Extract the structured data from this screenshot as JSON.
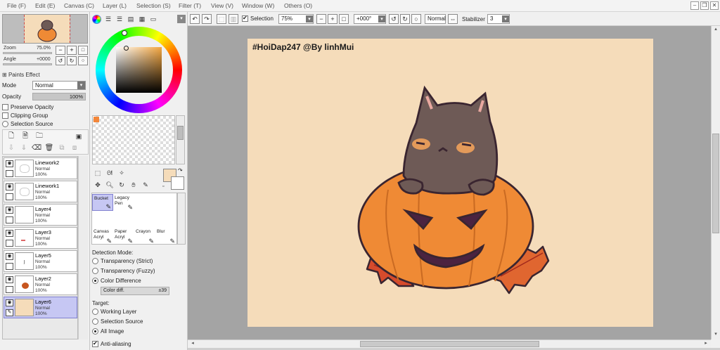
{
  "menubar": {
    "items": [
      "File (F)",
      "Edit (E)",
      "Canvas (C)",
      "Layer (L)",
      "Selection (S)",
      "Filter (T)",
      "View (V)",
      "Window (W)",
      "Others (O)"
    ]
  },
  "navigator": {
    "zoom_label": "Zoom",
    "zoom_value": "75.0%",
    "angle_label": "Angle",
    "angle_value": "+0000"
  },
  "layer_props": {
    "paints_effect": "Paints Effect",
    "mode_label": "Mode",
    "mode_value": "Normal",
    "opacity_label": "Opacity",
    "opacity_value": "100%",
    "preserve_opacity": "Preserve Opacity",
    "clipping_group": "Clipping Group",
    "selection_source": "Selection Source"
  },
  "layers": [
    {
      "name": "Linework2",
      "mode": "Normal",
      "opacity": "100%",
      "selected": false
    },
    {
      "name": "Linework1",
      "mode": "Normal",
      "opacity": "100%",
      "selected": false
    },
    {
      "name": "Layer4",
      "mode": "Normal",
      "opacity": "100%",
      "selected": false
    },
    {
      "name": "Layer3",
      "mode": "Normal",
      "opacity": "100%",
      "selected": false
    },
    {
      "name": "Layer5",
      "mode": "Normal",
      "opacity": "100%",
      "selected": false
    },
    {
      "name": "Layer2",
      "mode": "Normal",
      "opacity": "100%",
      "selected": false
    },
    {
      "name": "Layer6",
      "mode": "Normal",
      "opacity": "100%",
      "selected": true
    }
  ],
  "brushes": [
    {
      "label1": "Bucket",
      "label2": ""
    },
    {
      "label1": "Legacy",
      "label2": "Pen"
    },
    {
      "label1": "",
      "label2": ""
    },
    {
      "label1": "",
      "label2": ""
    },
    {
      "label1": "Canvas",
      "label2": "Acryl"
    },
    {
      "label1": "Paper",
      "label2": "Acryl"
    },
    {
      "label1": "Crayon",
      "label2": ""
    },
    {
      "label1": "Blur",
      "label2": ""
    }
  ],
  "bucket_options": {
    "detection_mode_label": "Detection Mode:",
    "opt_strict": "Transparency (Strict)",
    "opt_fuzzy": "Transparency (Fuzzy)",
    "opt_color_diff": "Color Difference",
    "color_diff_label": "Color diff.",
    "color_diff_value": "±39",
    "target_label": "Target:",
    "opt_working": "Working Layer",
    "opt_sel_source": "Selection Source",
    "opt_all_image": "All Image",
    "anti_aliasing": "Anti-aliasing"
  },
  "toolbar": {
    "selection_label": "Selection",
    "zoom_value": "75%",
    "angle_value": "+000°",
    "blend_mode": "Normal",
    "stabilizer_label": "Stabilizer",
    "stabilizer_value": "3"
  },
  "canvas": {
    "caption": "#HoiDap247 @By linhMui"
  },
  "colors": {
    "canvas_bg": "#f5dcba",
    "pumpkin": "#ef8a35",
    "cat": "#6e5a56",
    "primary_color": "#f5dcba",
    "swatch_orange": "#f3863a",
    "selected_layer": "#c6c7f3"
  }
}
